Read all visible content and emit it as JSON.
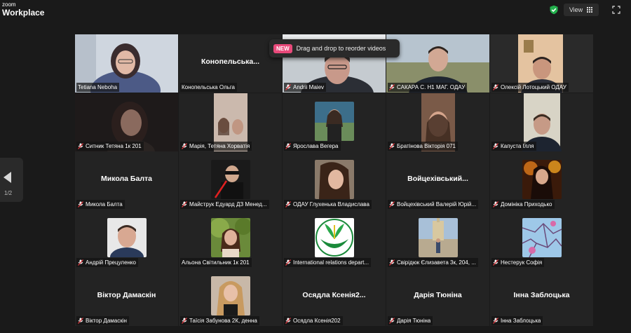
{
  "app": {
    "brand_top": "zoom",
    "brand_bottom": "Workplace"
  },
  "topbar": {
    "view_label": "View",
    "security_icon": "shield-check-icon",
    "fullscreen_icon": "fullscreen-icon"
  },
  "toast": {
    "badge": "NEW",
    "message": "Drag and drop to reorder videos"
  },
  "pager": {
    "label": "1/2"
  },
  "colors": {
    "active_speaker": "#3dd66b",
    "muted_mic": "#e0383e",
    "badge": "#e8497a"
  },
  "tiles": [
    {
      "name": "Tetiana Neboha",
      "kind": "video",
      "active": true
    },
    {
      "name": "Конопельська Ольга",
      "kind": "name",
      "display": "Конопельська..."
    },
    {
      "name": "Andrii Maiev",
      "kind": "video"
    },
    {
      "name": "САКАРА С. Н1  МАГ. ОДАУ",
      "kind": "video"
    },
    {
      "name": "Олексій Лотоцький ОДАУ",
      "kind": "video"
    },
    {
      "name": "Ситник Тетяна 1к 201",
      "kind": "video"
    },
    {
      "name": "Марія, Тетяна Хорватія",
      "kind": "video"
    },
    {
      "name": "Ярослава Вегера",
      "kind": "avatar"
    },
    {
      "name": "Братінова Вікторія 071",
      "kind": "video"
    },
    {
      "name": "Капуста Ілля",
      "kind": "video"
    },
    {
      "name": "Микола Балта",
      "kind": "name",
      "display": "Микола Балта"
    },
    {
      "name": "Майструк Едуард ДЗ Менед...",
      "kind": "avatar"
    },
    {
      "name": "ОДАУ Глухенька Владислава",
      "kind": "avatar"
    },
    {
      "name": "Войцехівський Валерій Юрій...",
      "kind": "name",
      "display": "Войцехівський..."
    },
    {
      "name": "Домініка Приходько",
      "kind": "avatar"
    },
    {
      "name": "Андрій Прецуленко",
      "kind": "avatar"
    },
    {
      "name": "Альона Світильник 1к 201",
      "kind": "avatar"
    },
    {
      "name": "International relations depart...",
      "kind": "avatar"
    },
    {
      "name": "Свірідюк Єлизавета 3к, 204, ...",
      "kind": "avatar"
    },
    {
      "name": "Нестерук Софія",
      "kind": "avatar"
    },
    {
      "name": "Віктор Дамаскін",
      "kind": "name",
      "display": "Віктор Дамаскін"
    },
    {
      "name": "Таїсія Забунова 2К, денна",
      "kind": "avatar"
    },
    {
      "name": "Осядла Ксенія202",
      "kind": "name",
      "display": "Осядла  Ксенія2..."
    },
    {
      "name": "Дарія Тюніна",
      "kind": "name",
      "display": "Дарія Тюніна"
    },
    {
      "name": "Інна Заблоцька",
      "kind": "name",
      "display": "Інна Заблоцька"
    }
  ]
}
